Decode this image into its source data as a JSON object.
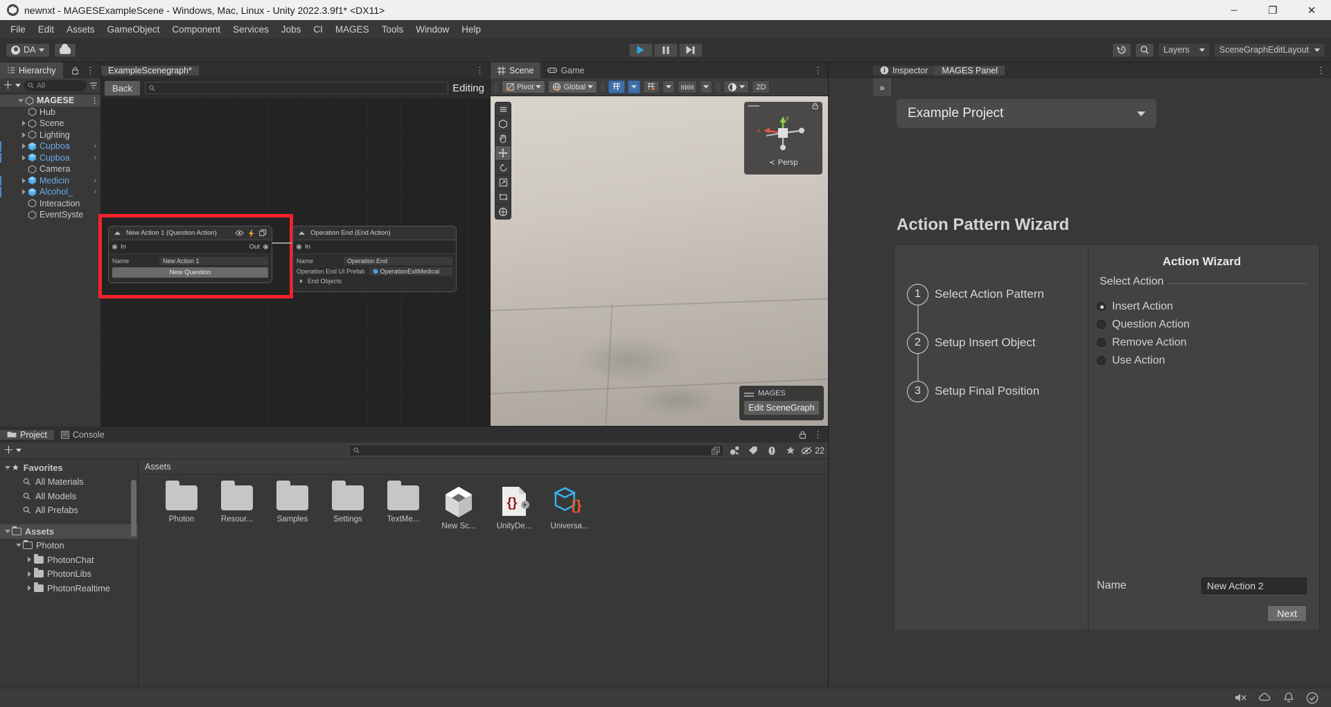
{
  "window": {
    "title": "newnxt - MAGESExampleScene - Windows, Mac, Linux - Unity 2022.3.9f1* <DX11>",
    "minimize": "–",
    "maximize": "❐",
    "close": "✕"
  },
  "menubar": [
    "File",
    "Edit",
    "Assets",
    "GameObject",
    "Component",
    "Services",
    "Jobs",
    "CI",
    "MAGES",
    "Tools",
    "Window",
    "Help"
  ],
  "toolbar": {
    "account_label": "DA",
    "layers_label": "Layers",
    "layout_label": "SceneGraphEditLayout"
  },
  "hierarchy": {
    "tab_label": "Hierarchy",
    "search_placeholder": "All",
    "items": [
      {
        "label": "MAGESE",
        "depth": 0,
        "arrow": "open",
        "pref": false,
        "root": true,
        "dots": true
      },
      {
        "label": "Hub",
        "depth": 1,
        "arrow": "none",
        "pref": false
      },
      {
        "label": "Scene",
        "depth": 1,
        "arrow": "closed",
        "pref": false
      },
      {
        "label": "Lighting",
        "depth": 1,
        "arrow": "closed",
        "pref": false
      },
      {
        "label": "Cupboa",
        "depth": 1,
        "arrow": "closed",
        "pref": true,
        "chev": true
      },
      {
        "label": "Cupboa",
        "depth": 1,
        "arrow": "closed",
        "pref": true,
        "chev": true
      },
      {
        "label": "Camera",
        "depth": 1,
        "arrow": "none",
        "pref": false
      },
      {
        "label": "Medicin",
        "depth": 1,
        "arrow": "closed",
        "pref": true,
        "chev": true
      },
      {
        "label": "Alcohol_",
        "depth": 1,
        "arrow": "closed",
        "pref": true,
        "chev": true
      },
      {
        "label": "Interaction",
        "depth": 1,
        "arrow": "none",
        "pref": false
      },
      {
        "label": "EventSyste",
        "depth": 1,
        "arrow": "none",
        "pref": false
      }
    ]
  },
  "scenegraph": {
    "tab_label": "ExampleScenegraph*",
    "back_label": "Back",
    "search_placeholder": "",
    "editing_label": "Editing",
    "nodes": [
      {
        "title": "New Action 1 (Question Action)",
        "in_label": "In",
        "out_label": "Out",
        "name_label": "Name",
        "name_value": "New Action 1",
        "button_label": "New Question"
      },
      {
        "title": "Operation End (End Action)",
        "in_label": "In",
        "name_label": "Name",
        "name_value": "Operation End",
        "prefab_label": "Operation End UI Prefab",
        "prefab_value": "OperationExitMedical",
        "endobjects_label": "End Objects"
      }
    ]
  },
  "sceneview": {
    "tab_scene": "Scene",
    "tab_game": "Game",
    "pivot_label": "Pivot",
    "global_label": "Global",
    "twod_label": "2D",
    "gizmo": {
      "x_label": "x",
      "y_label": "y",
      "persp_label": "Persp"
    },
    "overlay": {
      "title": "MAGES",
      "button": "Edit SceneGraph"
    }
  },
  "inspector": {
    "tab_inspector": "Inspector",
    "tab_mages_panel": "MAGES Panel",
    "project_dropdown": "Example Project",
    "panel_title": "Action Pattern Wizard",
    "steps": [
      {
        "num": "1",
        "label": "Select Action Pattern"
      },
      {
        "num": "2",
        "label": "Setup Insert Object"
      },
      {
        "num": "3",
        "label": "Setup Final Position"
      }
    ],
    "wizard": {
      "title": "Action Wizard",
      "legend": "Select Action",
      "options": [
        {
          "label": "Insert Action",
          "selected": true
        },
        {
          "label": "Question Action",
          "selected": false
        },
        {
          "label": "Remove Action",
          "selected": false
        },
        {
          "label": "Use Action",
          "selected": false
        }
      ],
      "name_label": "Name",
      "name_value": "New Action 2",
      "next_label": "Next"
    }
  },
  "project": {
    "tab_project": "Project",
    "tab_console": "Console",
    "search_placeholder": "",
    "hidden_count": "22",
    "assets_header": "Assets",
    "tree": [
      {
        "label": "Favorites",
        "depth": 0,
        "arrow": "open",
        "icon": "star"
      },
      {
        "label": "All Materials",
        "depth": 1,
        "arrow": "none",
        "icon": "search"
      },
      {
        "label": "All Models",
        "depth": 1,
        "arrow": "none",
        "icon": "search"
      },
      {
        "label": "All Prefabs",
        "depth": 1,
        "arrow": "none",
        "icon": "search"
      },
      {
        "label": "",
        "depth": 0,
        "arrow": "none",
        "icon": "none"
      },
      {
        "label": "Assets",
        "depth": 0,
        "arrow": "open",
        "icon": "folder-open",
        "selected": true
      },
      {
        "label": "Photon",
        "depth": 1,
        "arrow": "open",
        "icon": "folder-open"
      },
      {
        "label": "PhotonChat",
        "depth": 2,
        "arrow": "closed",
        "icon": "folder"
      },
      {
        "label": "PhotonLibs",
        "depth": 2,
        "arrow": "closed",
        "icon": "folder"
      },
      {
        "label": "PhotonRealtime",
        "depth": 2,
        "arrow": "closed",
        "icon": "folder"
      }
    ],
    "assets": [
      {
        "label": "Photon",
        "icon": "folder"
      },
      {
        "label": "Resour...",
        "icon": "folder"
      },
      {
        "label": "Samples",
        "icon": "folder"
      },
      {
        "label": "Settings",
        "icon": "folder"
      },
      {
        "label": "TextMe...",
        "icon": "folder"
      },
      {
        "label": "New Sc...",
        "icon": "unity-scene"
      },
      {
        "label": "UnityDe...",
        "icon": "json-file"
      },
      {
        "label": "Universa...",
        "icon": "urp-asset"
      }
    ]
  }
}
